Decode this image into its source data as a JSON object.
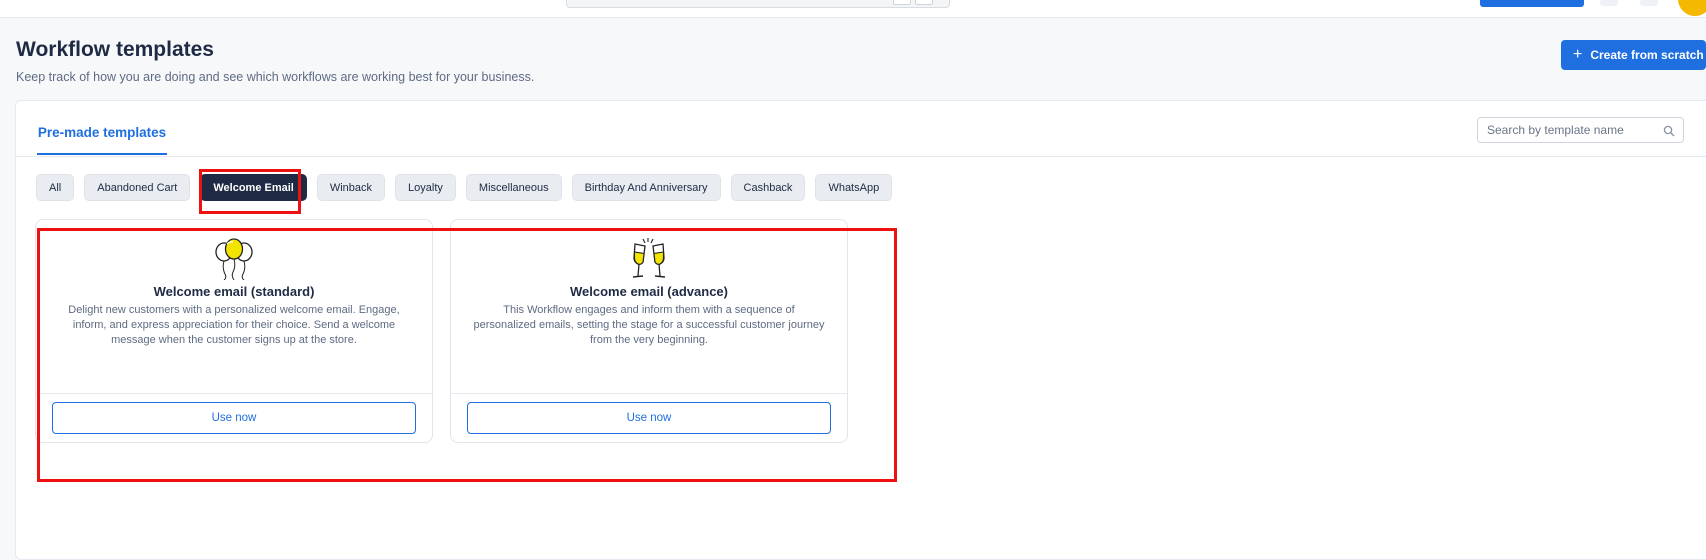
{
  "page": {
    "title": "Workflow templates",
    "subtitle": "Keep track of how you are doing and see which workflows are working best for your business.",
    "create_button": "Create from scratch"
  },
  "tabs": {
    "premade": "Pre-made templates"
  },
  "search": {
    "placeholder": "Search by template name"
  },
  "chips": [
    "All",
    "Abandoned Cart",
    "Welcome Email",
    "Winback",
    "Loyalty",
    "Miscellaneous",
    "Birthday And Anniversary",
    "Cashback",
    "WhatsApp"
  ],
  "active_chip": "Welcome Email",
  "cards": [
    {
      "title": "Welcome email (standard)",
      "description": "Delight new customers with a personalized welcome email. Engage, inform, and express appreciation for their choice. Send a welcome message when the customer signs up at the store.",
      "button": "Use now",
      "icon": "balloons-icon"
    },
    {
      "title": "Welcome email (advance)",
      "description": "This Workflow engages and inform them with a sequence of personalized emails, setting the stage for a successful customer journey from the very beginning.",
      "button": "Use now",
      "icon": "champagne-glasses-icon"
    }
  ],
  "colors": {
    "accent": "#1f6fe0",
    "active_chip": "#1f2a44",
    "highlight": "#ee1111",
    "icon_yellow": "#f2e400"
  }
}
